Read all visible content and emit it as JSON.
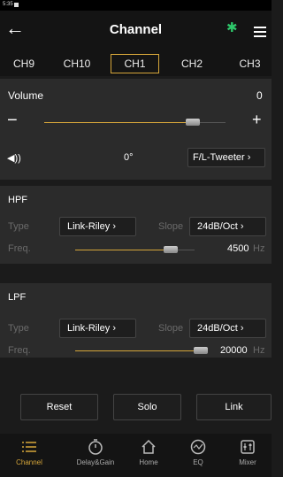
{
  "status_bar": {
    "time": "5:35"
  },
  "header": {
    "title": "Channel",
    "bluetooth_color": "#2ec96b"
  },
  "tabs": [
    "CH9",
    "CH10",
    "CH1",
    "CH2",
    "CH3"
  ],
  "active_tab": "CH1",
  "volume": {
    "label": "Volume",
    "value": "0",
    "minus": "−",
    "plus": "+",
    "slider_fraction": 0.82,
    "phase": "0°",
    "output": "F/L-Tweeter"
  },
  "hpf": {
    "title": "HPF",
    "type_label": "Type",
    "type_value": "Link-Riley",
    "slope_label": "Slope",
    "slope_value": "24dB/Oct",
    "freq_label": "Freq.",
    "freq_value": "4500",
    "freq_unit": "Hz",
    "slider_fraction": 0.8
  },
  "lpf": {
    "title": "LPF",
    "type_label": "Type",
    "type_value": "Link-Riley",
    "slope_label": "Slope",
    "slope_value": "24dB/Oct",
    "freq_label": "Freq.",
    "freq_value": "20000",
    "freq_unit": "Hz",
    "slider_fraction": 1.0
  },
  "actions": {
    "reset": "Reset",
    "solo": "Solo",
    "link": "Link"
  },
  "nav": [
    {
      "label": "Channel",
      "icon": "list-icon"
    },
    {
      "label": "Delay&Gain",
      "icon": "timer-icon"
    },
    {
      "label": "Home",
      "icon": "home-icon"
    },
    {
      "label": "EQ",
      "icon": "eq-icon"
    },
    {
      "label": "Mixer",
      "icon": "mixer-icon"
    }
  ],
  "accent_color": "#d6a63a"
}
